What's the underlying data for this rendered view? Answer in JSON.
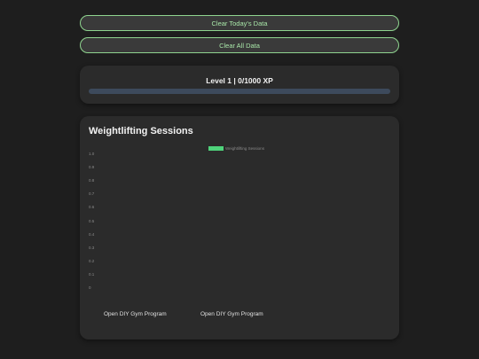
{
  "buttons": {
    "clear_today": "Clear Today's Data",
    "clear_all": "Clear All Data"
  },
  "level": {
    "text": "Level 1 | 0/1000 XP",
    "xp_fraction": 0
  },
  "chart": {
    "title": "Weightlifting Sessions"
  },
  "chart_data": {
    "type": "bar",
    "title": "Weightlifting Sessions",
    "categories": [
      "Open DIY Gym Program",
      "Open DIY Gym Program"
    ],
    "series": [
      {
        "name": "Weightlifting Sessions",
        "values": [
          0,
          0
        ]
      }
    ],
    "ylim": [
      0,
      1.0
    ],
    "yticks": [
      "1.0",
      "0.9",
      "0.8",
      "0.7",
      "0.6",
      "0.5",
      "0.4",
      "0.3",
      "0.2",
      "0.1",
      "0"
    ],
    "legend": "top",
    "grid": false
  },
  "colors": {
    "accent": "#8fd48f",
    "series": "#4fd37b",
    "progress_track": "#3d4a5c"
  }
}
